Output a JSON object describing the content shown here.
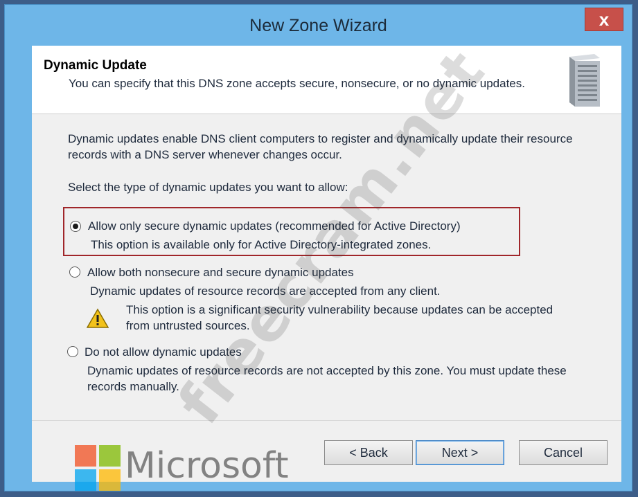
{
  "window": {
    "title": "New Zone Wizard",
    "close_label": "x"
  },
  "header": {
    "title": "Dynamic Update",
    "description": "You can specify that this DNS zone accepts secure, nonsecure, or no dynamic updates."
  },
  "body": {
    "intro": "Dynamic updates enable DNS client computers to register and dynamically update their resource records with a DNS server whenever changes occur.",
    "prompt": "Select the type of dynamic updates you want to allow:",
    "options": [
      {
        "label": "Allow only secure dynamic updates (recommended for Active Directory)",
        "description": "This option is available only for Active Directory-integrated zones.",
        "selected": true
      },
      {
        "label": "Allow both nonsecure and secure dynamic updates",
        "description": "Dynamic updates of resource records are accepted from any client.",
        "warning": "This option is a significant security vulnerability because updates can be accepted from untrusted sources.",
        "selected": false
      },
      {
        "label": "Do not allow dynamic updates",
        "description": "Dynamic updates of resource records are not accepted by this zone. You must update these records manually.",
        "selected": false
      }
    ]
  },
  "buttons": {
    "back": "< Back",
    "next": "Next >",
    "cancel": "Cancel"
  },
  "watermark": "freecram.net",
  "branding": "Microsoft",
  "colors": {
    "title_bar": "#6eb6e8",
    "close_button": "#c7504a",
    "highlight_border": "#a0262a"
  },
  "icons": [
    "server-icon",
    "warning-icon",
    "microsoft-logo"
  ]
}
